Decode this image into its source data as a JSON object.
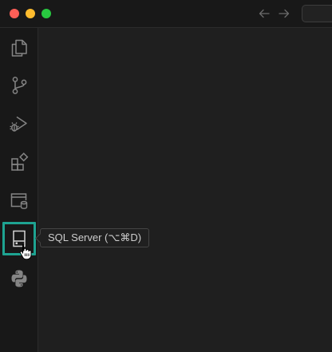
{
  "window": {
    "traffic_lights": [
      "close",
      "minimize",
      "maximize"
    ]
  },
  "titlebar": {
    "back_icon": "arrow-left-icon",
    "forward_icon": "arrow-right-icon"
  },
  "activity_bar": {
    "items": [
      {
        "id": "explorer",
        "icon": "files-icon"
      },
      {
        "id": "source-control",
        "icon": "source-control-icon"
      },
      {
        "id": "run-and-debug",
        "icon": "debug-alt-icon"
      },
      {
        "id": "extensions",
        "icon": "extensions-icon"
      },
      {
        "id": "database",
        "icon": "database-icon"
      },
      {
        "id": "sql-server",
        "icon": "server-icon",
        "active": true
      },
      {
        "id": "python",
        "icon": "python-icon"
      }
    ]
  },
  "tooltip": {
    "text": "SQL Server (⌥⌘D)"
  },
  "colors": {
    "accent": "#1ea391",
    "icon": "#858585",
    "background": "#1f1f1f",
    "sidebar": "#181818"
  }
}
